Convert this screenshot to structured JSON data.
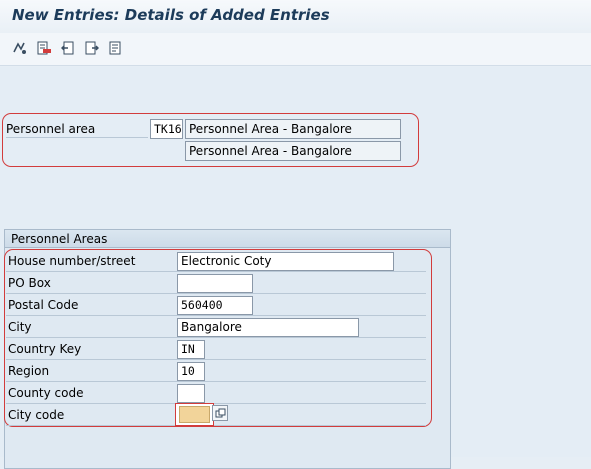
{
  "title": "New Entries: Details of Added Entries",
  "toolbar": {
    "buttons": [
      {
        "name": "display-change-icon"
      },
      {
        "name": "delete-icon"
      },
      {
        "name": "previous-entry-icon"
      },
      {
        "name": "next-entry-icon"
      },
      {
        "name": "details-icon"
      }
    ]
  },
  "header": {
    "personnel_area_label": "Personnel area",
    "personnel_area_code": "TK16",
    "personnel_area_text1": "Personnel Area - Bangalore",
    "personnel_area_text2": "Personnel Area - Bangalore"
  },
  "group": {
    "title": "Personnel Areas",
    "fields": {
      "house": {
        "label": "House number/street",
        "value": "Electronic Coty"
      },
      "pobox": {
        "label": "PO Box",
        "value": ""
      },
      "postal": {
        "label": "Postal Code",
        "value": "560400"
      },
      "city": {
        "label": "City",
        "value": "Bangalore"
      },
      "country": {
        "label": "Country Key",
        "value": "IN"
      },
      "region": {
        "label": "Region",
        "value": "10"
      },
      "county": {
        "label": "County code",
        "value": ""
      },
      "citycode": {
        "label": "City code",
        "value": ""
      }
    }
  },
  "colors": {
    "highlight": "#d23c3c",
    "focus_field": "#f2d49a"
  }
}
